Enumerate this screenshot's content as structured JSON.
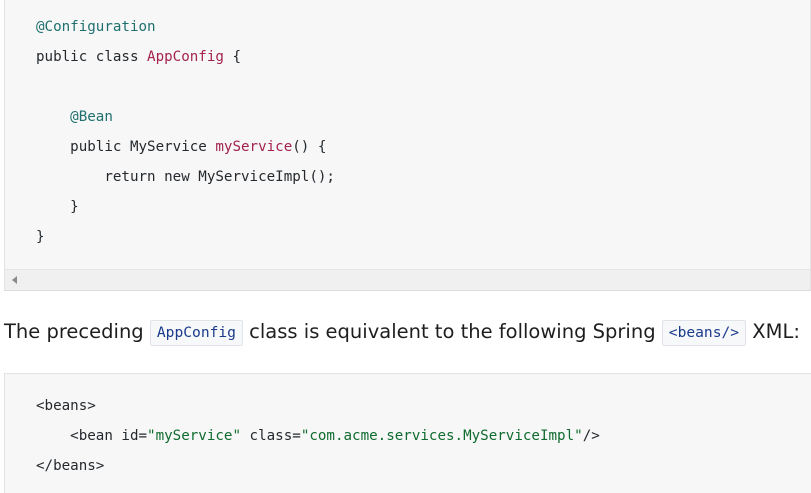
{
  "code_block_1": {
    "lines": [
      {
        "parts": [
          {
            "cls": "tok-annotation",
            "text": "@Configuration"
          }
        ]
      },
      {
        "parts": [
          {
            "cls": "tok-keyword",
            "text": "public class "
          },
          {
            "cls": "tok-title",
            "text": "AppConfig"
          },
          {
            "cls": "tok-plain",
            "text": " {"
          }
        ]
      },
      {
        "parts": [
          {
            "cls": "tok-plain",
            "text": ""
          }
        ]
      },
      {
        "parts": [
          {
            "cls": "tok-annotation",
            "text": "    @Bean"
          }
        ]
      },
      {
        "parts": [
          {
            "cls": "tok-keyword",
            "text": "    public "
          },
          {
            "cls": "tok-type",
            "text": "MyService "
          },
          {
            "cls": "tok-title",
            "text": "myService"
          },
          {
            "cls": "tok-plain",
            "text": "() {"
          }
        ]
      },
      {
        "parts": [
          {
            "cls": "tok-keyword",
            "text": "        return new "
          },
          {
            "cls": "tok-plain",
            "text": "MyServiceImpl();"
          }
        ]
      },
      {
        "parts": [
          {
            "cls": "tok-plain",
            "text": "    }"
          }
        ]
      },
      {
        "parts": [
          {
            "cls": "tok-plain",
            "text": "}"
          }
        ]
      }
    ]
  },
  "paragraph": {
    "before": "The preceding ",
    "code1": "AppConfig",
    "middle": " class is equivalent to the following Spring ",
    "code2": "<beans/>",
    "after": " XML:"
  },
  "code_block_2": {
    "lines": [
      {
        "parts": [
          {
            "cls": "tok-tag",
            "text": "<beans>"
          }
        ]
      },
      {
        "parts": [
          {
            "cls": "tok-tag",
            "text": "    <bean "
          },
          {
            "cls": "tok-attr",
            "text": "id="
          },
          {
            "cls": "tok-string",
            "text": "\"myService\""
          },
          {
            "cls": "tok-attr",
            "text": " class="
          },
          {
            "cls": "tok-string",
            "text": "\"com.acme.services.MyServiceImpl\""
          },
          {
            "cls": "tok-tag",
            "text": "/>"
          }
        ]
      },
      {
        "parts": [
          {
            "cls": "tok-tag",
            "text": "</beans>"
          }
        ]
      }
    ]
  }
}
